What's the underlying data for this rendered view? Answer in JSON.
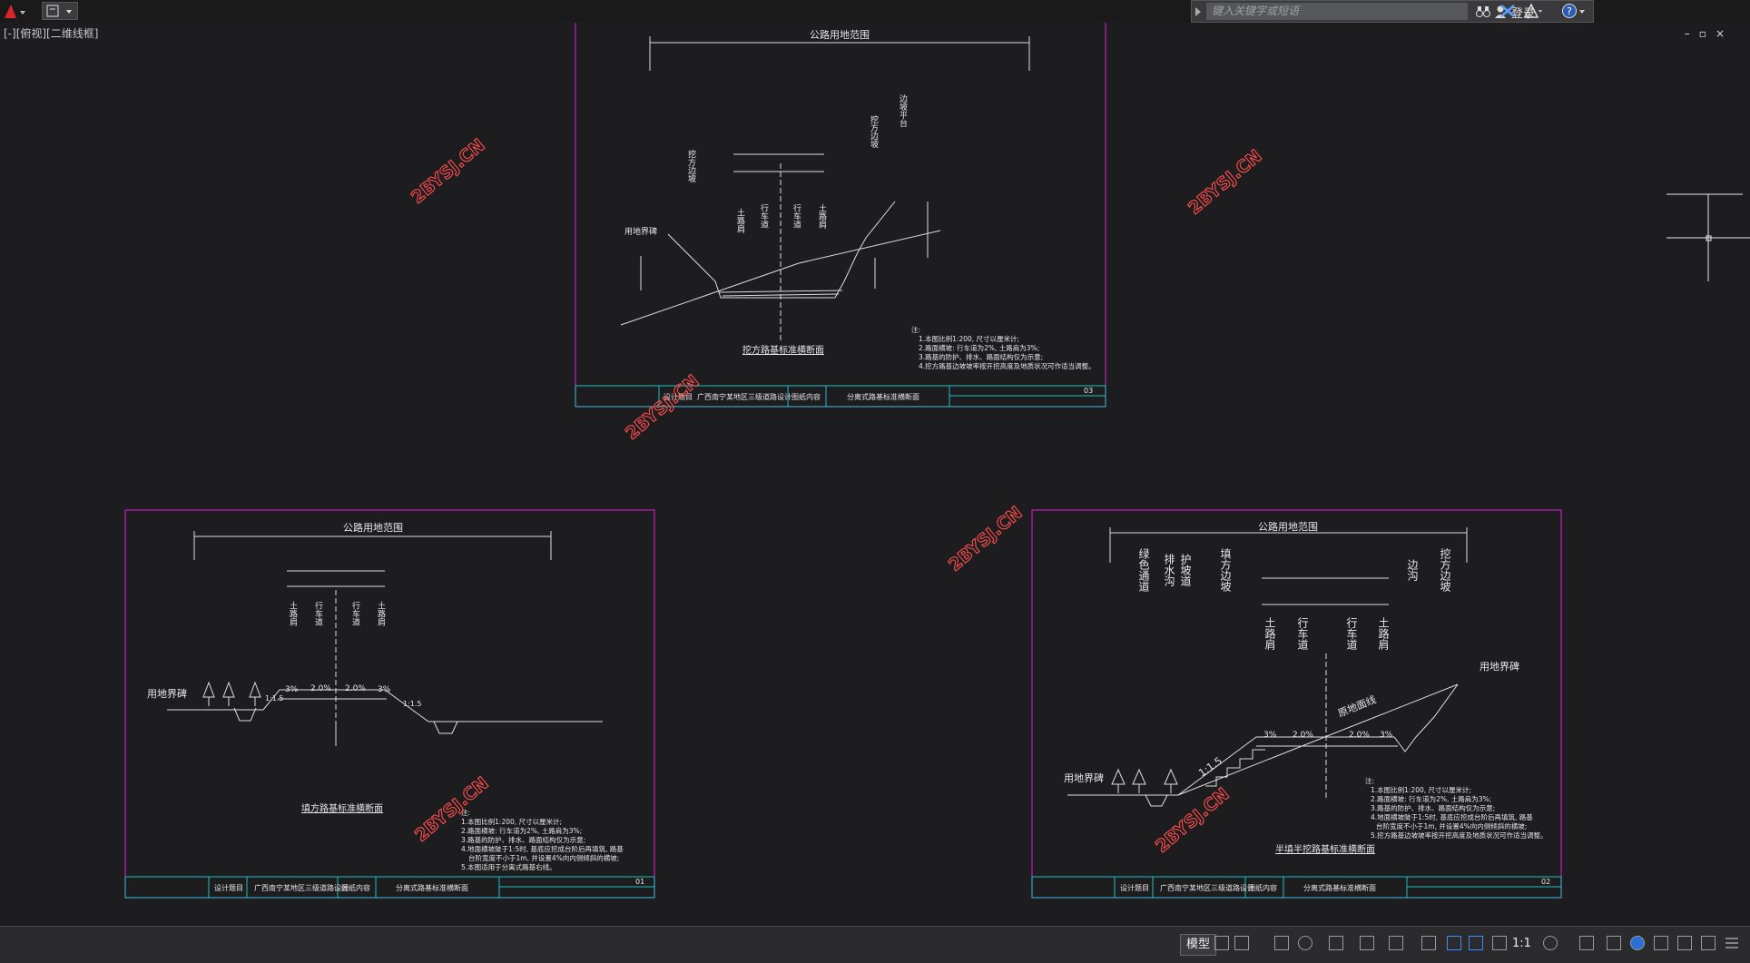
{
  "app": {
    "logo_letter": "A",
    "icons": [
      "autocad-logo-icon",
      "quick-access-icon"
    ]
  },
  "search": {
    "placeholder": "键入关键字或短语",
    "login_label": "登录"
  },
  "viewport_label": "[-][俯视][二维线框]",
  "window_controls": [
    "minimize-icon",
    "restore-icon",
    "close-icon"
  ],
  "watermark": "2BYSJ.CN",
  "drawings": {
    "top": {
      "header": "公路用地范围",
      "section_title": "挖方路基标准横断面",
      "labels": [
        "土路肩",
        "行车道",
        "行车道",
        "土路肩",
        "挖方边坡",
        "挖方边坡",
        "边坡平台",
        "用地界碑"
      ],
      "notes": [
        "注:",
        "1.本图比例1:200, 尺寸以厘米计;",
        "2.路面横坡: 行车道为2%, 土路肩为3%;",
        "3.路基的防护、排水、路面结构仅为示意;",
        "4.挖方路基边坡坡率按开挖高度及地质状况可作适当调整。"
      ],
      "title_block": {
        "project_label": "设计题目",
        "project": "广西南宁某地区三级道路设计",
        "content_label": "图纸内容",
        "content": "分离式路基标准横断面",
        "page": "03"
      }
    },
    "left": {
      "header": "公路用地范围",
      "section_title": "填方路基标准横断面",
      "labels": [
        "土路肩",
        "行车道",
        "行车道",
        "土路肩",
        "用地界碑"
      ],
      "slopes": [
        "3%",
        "2.0%",
        "2.0%",
        "3%",
        "1:1.5",
        "1:1.5"
      ],
      "notes": [
        "注:",
        "1.本图比例1:200, 尺寸以厘米计;",
        "2.路面横坡: 行车道为2%, 土路肩为3%;",
        "3.路基的防护、排水、路面结构仅为示意;",
        "4.地面横坡陡于1:5时, 基底应挖成台阶后再填筑, 路基",
        "台阶宽度不小于1m, 并设置4%向内侧倾斜的横坡;",
        "5.本图适用于分离式路基右线。"
      ],
      "title_block": {
        "project_label": "设计题目",
        "project": "广西南宁某地区三级道路设计",
        "content_label": "图纸内容",
        "content": "分离式路基标准横断面",
        "page": "01"
      }
    },
    "right": {
      "header": "公路用地范围",
      "section_title": "半填半挖路基标准横断面",
      "labels": [
        "绿色通道",
        "排水沟",
        "护坡道",
        "填方边坡",
        "土路肩",
        "行车道",
        "行车道",
        "土路肩",
        "边沟",
        "挖方边坡",
        "用地界碑",
        "原地面线"
      ],
      "slopes": [
        "3%",
        "2.0%",
        "2.0%",
        "3%",
        "1:1.5"
      ],
      "notes": [
        "注:",
        "1.本图比例1:200, 尺寸以厘米计;",
        "2.路面横坡: 行车道为2%, 土路肩为3%;",
        "3.路基的防护、排水、路面结构仅为示意;",
        "4.地面横坡陡于1:5时, 基底应挖成台阶后再填筑, 路基",
        "台阶宽度不小于1m, 并设置4%向内侧倾斜的横坡;",
        "5.挖方路基边坡坡率按开挖高度及地质状况可作适当调整。"
      ],
      "title_block": {
        "project_label": "设计题目",
        "project": "广西南宁某地区三级道路设计",
        "content_label": "图纸内容",
        "content": "分离式路基标准横断面",
        "page": "02"
      }
    }
  },
  "statusbar": {
    "model_tab": "模型",
    "scale": "1:1"
  }
}
